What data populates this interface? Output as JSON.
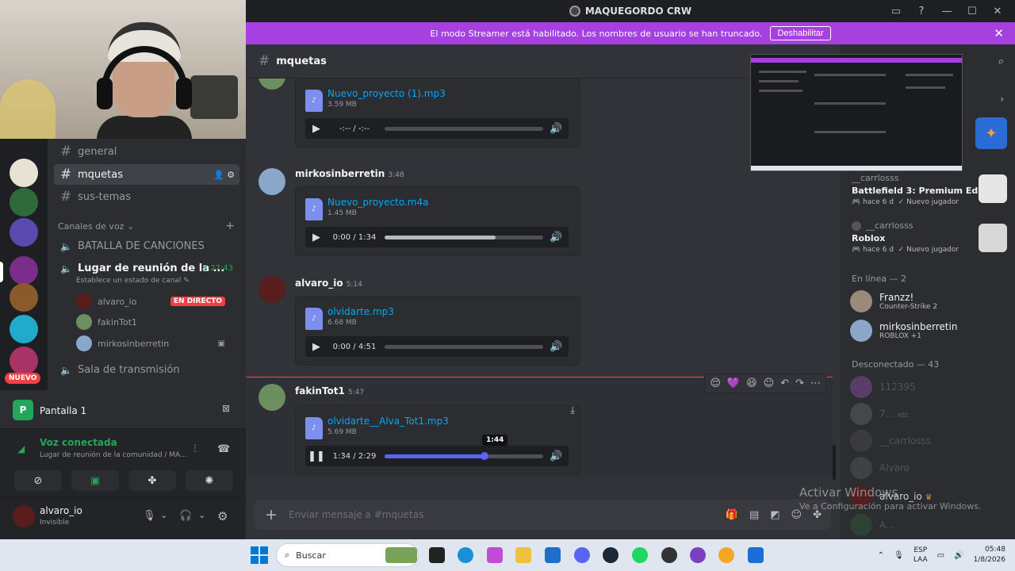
{
  "window": {
    "title": "MAQUEGORDO CRW",
    "buttons": [
      "▭",
      "?",
      "—",
      "☐",
      "✕"
    ]
  },
  "banner": {
    "text": "El modo Streamer está habilitado. Los nombres de usuario se han truncado.",
    "button": "Deshabilitar"
  },
  "channels": {
    "text": [
      {
        "label": "general"
      },
      {
        "label": "mquetas",
        "active": true
      },
      {
        "label": "sus-temas"
      }
    ],
    "voice_category": "Canales de voz",
    "voice": [
      {
        "label": "BATALLA DE CANCIONES"
      },
      {
        "label": "Lugar de reunión de la ...",
        "timer": "3:27:43",
        "status": "Establece un estado de canal"
      },
      {
        "label": "Sala de transmisión"
      }
    ],
    "voice_users": [
      {
        "name": "alvaro_io",
        "badge": "EN DIRECTO",
        "color": "#5a1d1d"
      },
      {
        "name": "fakinTot1",
        "color": "#6b8f5e"
      },
      {
        "name": "mirkosinberretin",
        "color": "#8aa6c9"
      }
    ]
  },
  "servers": {
    "new_badge": "NUEVO",
    "colors": [
      "#e8e2d5",
      "#2f6b3a",
      "#5a4ab0",
      "#7c2d8c",
      "#8a5a2a",
      "#22aacc",
      "#aa3366"
    ]
  },
  "screenshare": {
    "label": "Pantalla 1"
  },
  "voice_panel": {
    "status": "Voz conectada",
    "location": "Lugar de reunión de la comunidad / MA..."
  },
  "user_panel": {
    "name": "alvaro_io",
    "status": "Invisible"
  },
  "chat": {
    "channel": "mquetas",
    "input_placeholder": "Enviar mensaje a #mquetas",
    "messages": [
      {
        "file": "Nuevo_proyecto (1).mp3",
        "size": "3.59 MB",
        "time_display": "-:-- / -:--",
        "progress": 0
      },
      {
        "author": "mirkosinberretin",
        "time": "3:48",
        "avatar_color": "#8aa6c9",
        "file": "Nuevo_proyecto.m4a",
        "size": "1.45 MB",
        "time_display": "0:00 / 1:34",
        "progress": 0.7
      },
      {
        "author": "alvaro_io",
        "time": "5:14",
        "avatar_color": "#5a1d1d",
        "file": "olvidarte.mp3",
        "size": "6.68 MB",
        "time_display": "0:00 / 4:51",
        "progress": 0
      },
      {
        "author": "fakinTot1",
        "time": "5:47",
        "avatar_color": "#6b8f5e",
        "file": "olvidarte__Alva_Tot1.mp3",
        "size": "5.69 MB",
        "time_display": "1:34 / 2:29",
        "progress": 0.63,
        "tooltip": "1:44"
      }
    ],
    "reactions": [
      "😌",
      "💜",
      "😆",
      "☺",
      "↶",
      "↷",
      "⋯"
    ]
  },
  "members": {
    "activities": [
      {
        "user": "__carrlosss",
        "game": "Battlefield 3: Premium Edit...",
        "meta": "hace 6 d",
        "tag": "Nuevo jugador",
        "icon_color": "#e6e6e6"
      },
      {
        "user": "__carrlosss",
        "game": "Roblox",
        "meta": "hace 6 d",
        "tag": "Nuevo jugador",
        "icon_color": "#d8d8d8"
      }
    ],
    "online_header": "En línea — 2",
    "online": [
      {
        "name": "Franzz!",
        "sub": "Counter-Strike 2",
        "color": "#9b8a7a"
      },
      {
        "name": "mirkosinberretin",
        "sub": "ROBLOX +1",
        "color": "#8aa6c9"
      }
    ],
    "offline_header": "Desconectado — 43",
    "offline": [
      {
        "name": "112395",
        "color": "#b05ad0"
      },
      {
        "name": "7...",
        "sub": "xtc",
        "color": "#777"
      },
      {
        "name": "__carrlosss",
        "color": "#555"
      },
      {
        "name": "Alvaro",
        "color": "#666"
      },
      {
        "name": "alvaro_io",
        "color": "#5a1d1d"
      },
      {
        "name": "A...",
        "color": "#2f6b3a"
      }
    ]
  },
  "watermark": {
    "line1": "Activar Windows",
    "line2": "Ve a Configuración para activar Windows."
  },
  "taskbar": {
    "search": "Buscar",
    "lang1": "ESP",
    "lang2": "LAA",
    "time": "05:48",
    "date": "1/8/2026"
  }
}
